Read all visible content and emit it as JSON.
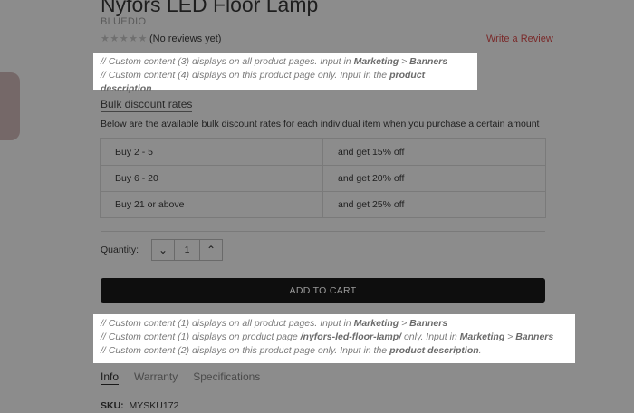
{
  "product": {
    "title": "Nyfors LED Floor Lamp",
    "brand": "BLUEDIO",
    "stars": "★★★★★",
    "reviews": "(No reviews yet)",
    "write_review": "Write a Review"
  },
  "note_top": {
    "line1_prefix": "// Custom content (3) displays on all product pages. Input in ",
    "line1_b1": "Marketing",
    "line1_sep": " > ",
    "line1_b2": "Banners",
    "line2_prefix": "// Custom content (4) displays on this product page only. Input in the ",
    "line2_b": "product description",
    "line2_suffix": "."
  },
  "bulk": {
    "title": "Bulk discount rates",
    "description": "Below are the available bulk discount rates for each individual item when you purchase a certain amount",
    "rows": [
      {
        "qty": "Buy 2 - 5",
        "discount": "and get 15% off"
      },
      {
        "qty": "Buy 6 - 20",
        "discount": "and get 20% off"
      },
      {
        "qty": "Buy 21 or above",
        "discount": "and get 25% off"
      }
    ]
  },
  "quantity": {
    "label": "Quantity:",
    "value": "1",
    "decrement_glyph": "⌄",
    "increment_glyph": "⌃"
  },
  "add_to_cart": "ADD TO CART",
  "note_bottom": {
    "line1_prefix": "// Custom content (1) displays on all product pages. Input in ",
    "line1_b1": "Marketing",
    "line1_sep": " > ",
    "line1_b2": "Banners",
    "line2_prefix": "// Custom content (1) displays on product page ",
    "line2_link": "/nyfors-led-floor-lamp/",
    "line2_mid": " only. Input in ",
    "line2_b1": "Marketing",
    "line2_sep": " > ",
    "line2_b2": "Banners",
    "line3_prefix": "// Custom content (2) displays on this product page only. Input in the ",
    "line3_b": "product description",
    "line3_suffix": "."
  },
  "tabs": [
    "Info",
    "Warranty",
    "Specifications"
  ],
  "sku": {
    "label": "SKU:",
    "value": "MYSKU172"
  }
}
